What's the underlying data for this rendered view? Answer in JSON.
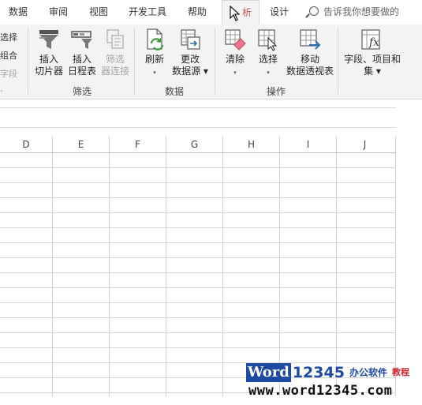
{
  "tabs": {
    "data": "数据",
    "review": "审阅",
    "view": "视图",
    "developer": "开发工具",
    "help": "帮助",
    "analyze": "析",
    "design": "设计"
  },
  "tell_me": {
    "placeholder": "告诉我你想要做的"
  },
  "left_partial": {
    "item1": "选择",
    "item2": "组合",
    "item3": "字段"
  },
  "groups": {
    "filter": "筛选",
    "data": "数据",
    "actions": "操作"
  },
  "buttons": {
    "insert_slicer": {
      "line1": "插入",
      "line2": "切片器"
    },
    "insert_timeline": {
      "line1": "插入",
      "line2": "日程表"
    },
    "filter_connections": {
      "line1": "筛选",
      "line2": "器连接"
    },
    "refresh": {
      "line1": "刷新",
      "caret": "▾"
    },
    "change_source": {
      "line1": "更改",
      "line2": "数据源 ▾"
    },
    "clear": {
      "line1": "清除",
      "caret": "▾"
    },
    "select": {
      "line1": "选择",
      "caret": "▾"
    },
    "move": {
      "line1": "移动",
      "line2": "数据透视表"
    },
    "fields": {
      "line1": "字段、项目和",
      "line2": "集 ▾"
    }
  },
  "columns": [
    "D",
    "E",
    "F",
    "G",
    "H",
    "I",
    "J"
  ],
  "watermark": {
    "brand": "Word",
    "number": "12345",
    "chinese": "办公软件",
    "tag": "教程",
    "url": "www.word12345.com"
  }
}
